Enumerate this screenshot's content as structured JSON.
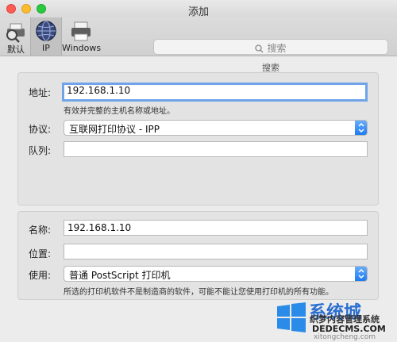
{
  "window": {
    "title": "添加"
  },
  "toolbar": {
    "items": [
      {
        "label": "默认",
        "icon": "default-printer-icon"
      },
      {
        "label": "IP",
        "icon": "ip-globe-icon"
      },
      {
        "label": "Windows",
        "icon": "windows-printer-icon"
      }
    ],
    "search_placeholder": "搜索",
    "search_label": "搜索"
  },
  "form": {
    "address_label": "地址:",
    "address_value": "192.168.1.10",
    "address_hint": "有效并完整的主机名称或地址。",
    "protocol_label": "协议:",
    "protocol_value": "互联网打印协议 - IPP",
    "queue_label": "队列:",
    "queue_value": "",
    "name_label": "名称:",
    "name_value": "192.168.1.10",
    "location_label": "位置:",
    "location_value": "",
    "use_label": "使用:",
    "use_value": "普通 PostScript 打印机",
    "use_hint": "所选的打印机软件不是制造商的软件，可能不能让您使用打印机的所有功能。"
  },
  "watermark": {
    "big": "系统城",
    "mid": "织梦内容管理系统",
    "url": "DEDECMS.COM",
    "small": "xitongcheng.com"
  },
  "colors": {
    "accent": "#1a78f0",
    "focus": "#6fa5e8"
  }
}
